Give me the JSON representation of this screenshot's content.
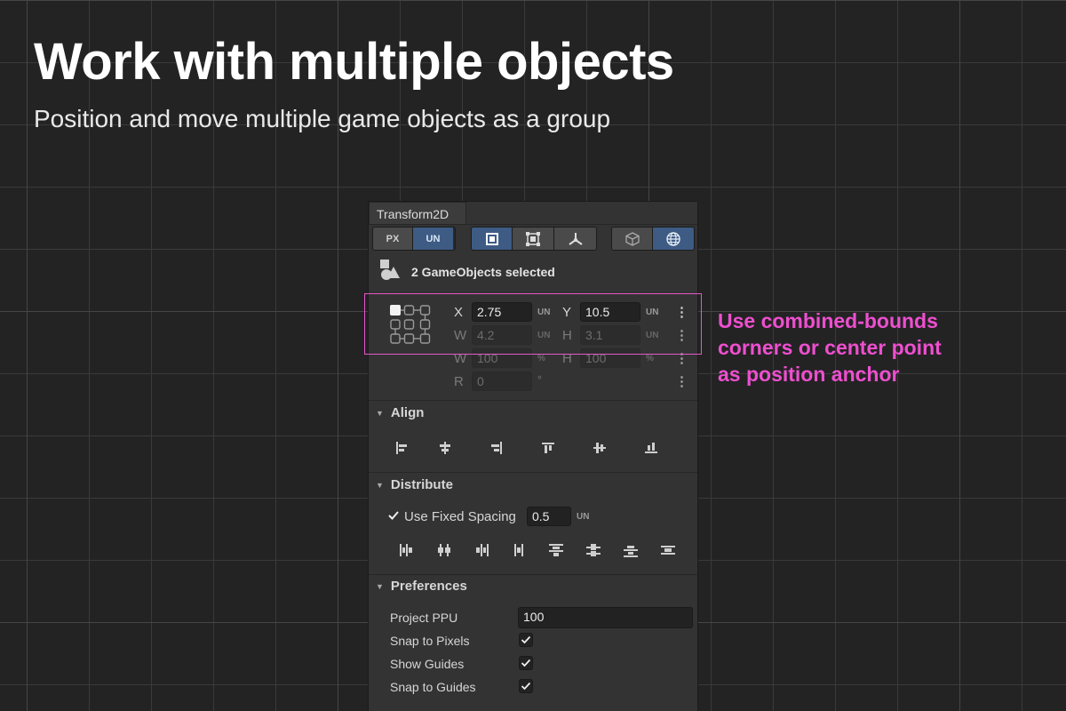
{
  "headline": "Work with multiple objects",
  "subheadline": "Position and move multiple game objects as a group",
  "panel": {
    "tab_title": "Transform2D",
    "unit_toggle": {
      "px_label": "PX",
      "un_label": "UN",
      "selected": "UN"
    },
    "mode_buttons": [
      "rect-tool-icon",
      "bounds-tool-icon",
      "pivot-tool-icon"
    ],
    "space_buttons": [
      "local-cube-icon",
      "world-globe-icon"
    ],
    "selection_text": "2 GameObjects selected",
    "fields": {
      "x_label": "X",
      "x_value": "2.75",
      "x_unit": "UN",
      "y_label": "Y",
      "y_value": "10.5",
      "y_unit": "UN",
      "w_label": "W",
      "w_value": "4.2",
      "w_unit": "UN",
      "h_label": "H",
      "h_value": "3.1",
      "h_unit": "UN",
      "wp_label": "W",
      "wp_value": "100",
      "wp_unit": "%",
      "hp_label": "H",
      "hp_value": "100",
      "hp_unit": "%",
      "r_label": "R",
      "r_value": "0",
      "r_unit": "°"
    },
    "align": {
      "title": "Align",
      "buttons": [
        "align-left-icon",
        "align-center-h-icon",
        "align-right-icon",
        "align-top-icon",
        "align-middle-v-icon",
        "align-bottom-icon"
      ]
    },
    "distribute": {
      "title": "Distribute",
      "fixed_spacing_label": "Use Fixed Spacing",
      "fixed_spacing_checked": true,
      "fixed_spacing_value": "0.5",
      "fixed_spacing_unit": "UN",
      "buttons": [
        "distribute-left-icon",
        "distribute-center-h-icon",
        "distribute-right-icon",
        "distribute-h-spacing-icon",
        "distribute-top-icon",
        "distribute-middle-v-icon",
        "distribute-bottom-icon",
        "distribute-v-spacing-icon"
      ]
    },
    "preferences": {
      "title": "Preferences",
      "ppu_label": "Project PPU",
      "ppu_value": "100",
      "snap_pixels_label": "Snap to Pixels",
      "snap_pixels_checked": true,
      "show_guides_label": "Show Guides",
      "show_guides_checked": true,
      "snap_guides_label": "Snap to Guides",
      "snap_guides_checked": true
    }
  },
  "callout_text": "Use combined-bounds\ncorners or center point\nas position anchor",
  "colors": {
    "accent": "#3e5b84",
    "highlight": "#e357c8",
    "callout": "#ee4fd0",
    "background": "#232323",
    "panel": "#333333"
  }
}
